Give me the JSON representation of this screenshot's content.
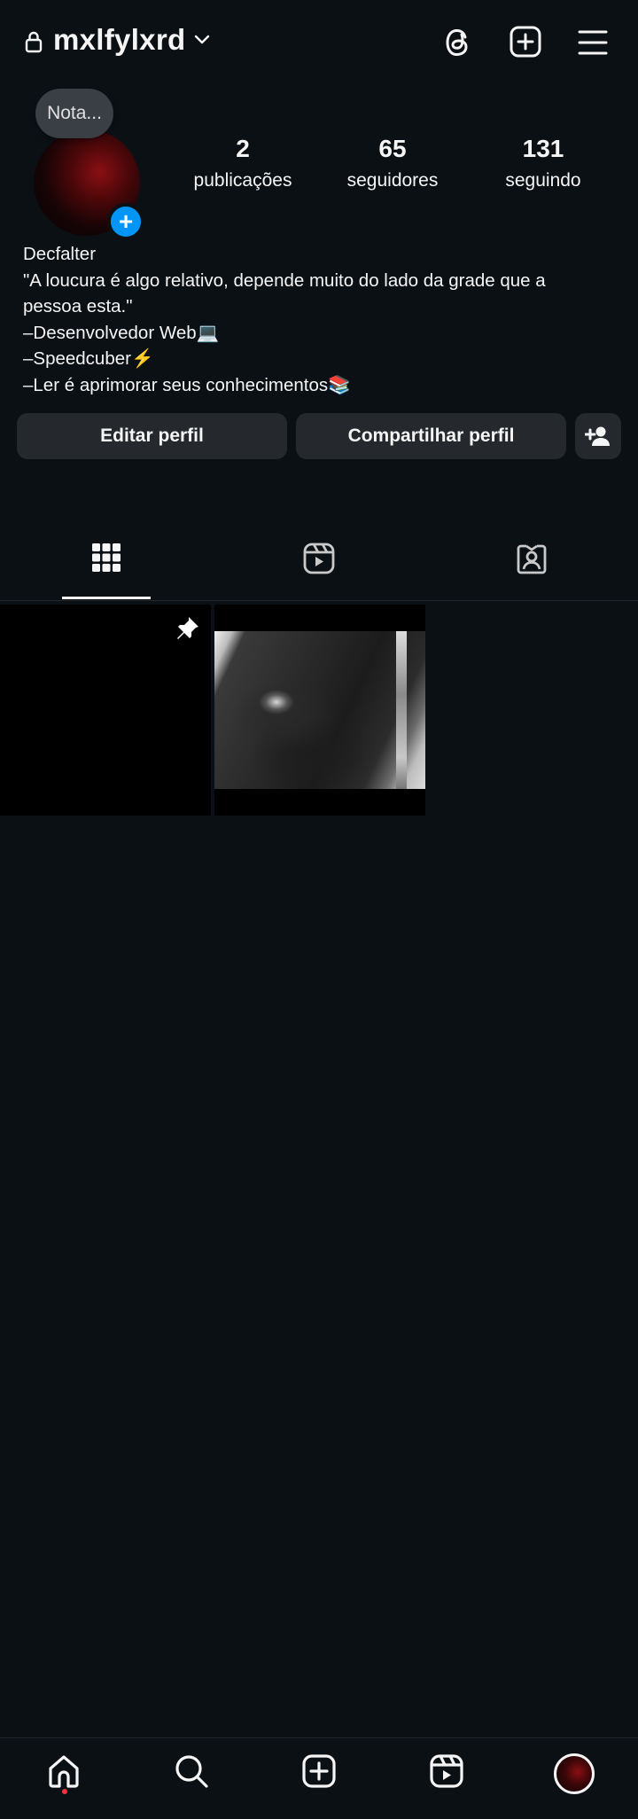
{
  "header": {
    "username": "mxlfylxrd"
  },
  "profile": {
    "note_label": "Nota...",
    "add_story": "+",
    "stats": [
      {
        "value": "2",
        "label": "publicações"
      },
      {
        "value": "65",
        "label": "seguidores"
      },
      {
        "value": "131",
        "label": "seguindo"
      }
    ],
    "name": "Decfalter",
    "bio_lines": [
      "\"A loucura é algo relativo, depende muito do lado da grade que a",
      "pessoa esta.\"",
      "–Desenvolvedor Web💻",
      "–Speedcuber⚡",
      "–Ler é aprimorar seus conhecimentos📚"
    ]
  },
  "actions": {
    "edit_label": "Editar perfil",
    "share_label": "Compartilhar perfil"
  },
  "tabs": [
    {
      "name": "posts-grid",
      "icon": "grid-icon",
      "active": true
    },
    {
      "name": "reels",
      "icon": "reels-icon",
      "active": false
    },
    {
      "name": "tagged",
      "icon": "tagged-person-icon",
      "active": false
    }
  ],
  "posts": [
    {
      "pinned": true,
      "image": "black-image"
    },
    {
      "pinned": false,
      "image": "dark-grayscale-photo"
    }
  ],
  "bottom_nav": [
    {
      "icon": "home-icon",
      "active": true
    },
    {
      "icon": "search-icon"
    },
    {
      "icon": "create-icon"
    },
    {
      "icon": "reels-icon"
    },
    {
      "icon": "profile-avatar"
    }
  ],
  "colors": {
    "background": "#0b1015",
    "button": "#25292e",
    "accent": "#0095f6",
    "notification": "#ff3040"
  }
}
